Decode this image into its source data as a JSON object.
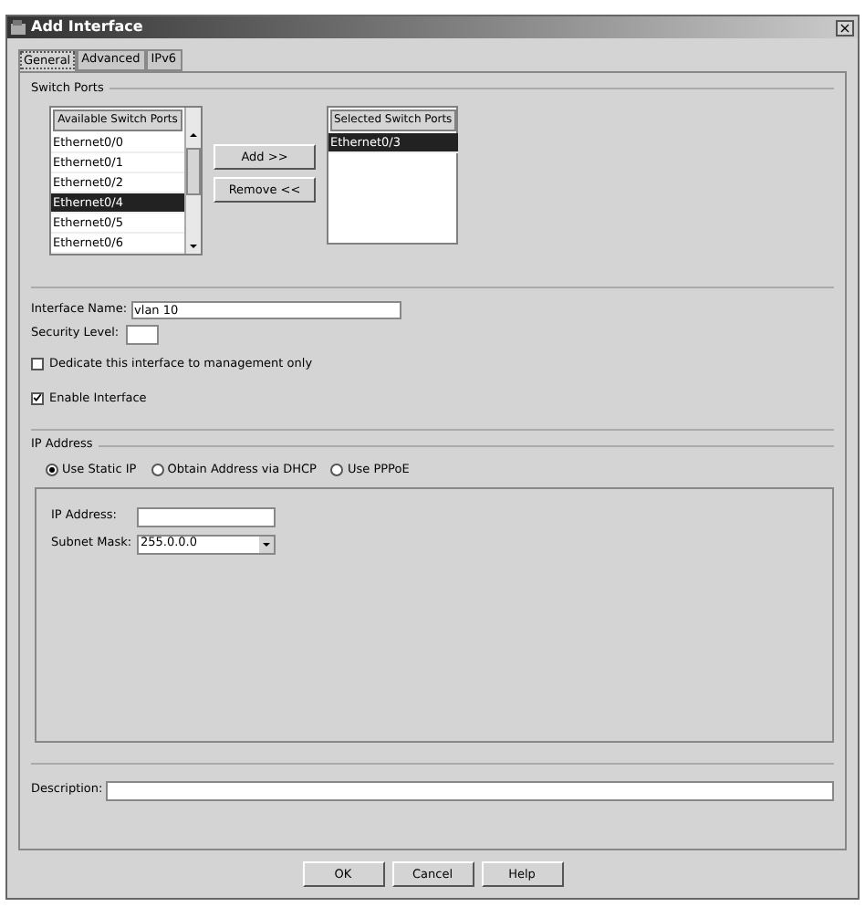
{
  "window": {
    "title": "Add Interface",
    "close": "×"
  },
  "tabs": [
    {
      "label": "General",
      "selected": true
    },
    {
      "label": "Advanced",
      "selected": false
    },
    {
      "label": "IPv6",
      "selected": false
    }
  ],
  "switch_ports": {
    "title": "Switch Ports",
    "available": {
      "header": "Available Switch Ports",
      "items": [
        {
          "label": "Ethernet0/0",
          "selected": false
        },
        {
          "label": "Ethernet0/1",
          "selected": false
        },
        {
          "label": "Ethernet0/2",
          "selected": false
        },
        {
          "label": "Ethernet0/4",
          "selected": true
        },
        {
          "label": "Ethernet0/5",
          "selected": false
        },
        {
          "label": "Ethernet0/6",
          "selected": false
        }
      ]
    },
    "add_button": "Add >>",
    "remove_button": "Remove <<",
    "selected_ports": {
      "header": "Selected Switch Ports",
      "items": [
        {
          "label": "Ethernet0/3",
          "selected": true
        }
      ]
    }
  },
  "interface_name": {
    "label": "Interface Name:",
    "value": "vlan 10"
  },
  "security_level": {
    "label": "Security Level:"
  },
  "checkboxes": [
    {
      "label": "Dedicate this interface to management only",
      "checked": false
    },
    {
      "label": "Enable Interface",
      "checked": true
    }
  ],
  "ip_address": {
    "title": "IP Address",
    "radios": [
      {
        "label": "Use Static IP",
        "selected": true
      },
      {
        "label": "Obtain Address via DHCP",
        "selected": false
      },
      {
        "label": "Use PPPoE",
        "selected": false
      }
    ],
    "ip_field": {
      "label": "IP Address:"
    },
    "subnet_mask": {
      "label": "Subnet Mask:",
      "value": "255.0.0.0"
    }
  },
  "description": {
    "label": "Description:"
  },
  "buttons": [
    "OK",
    "Cancel",
    "Help"
  ]
}
